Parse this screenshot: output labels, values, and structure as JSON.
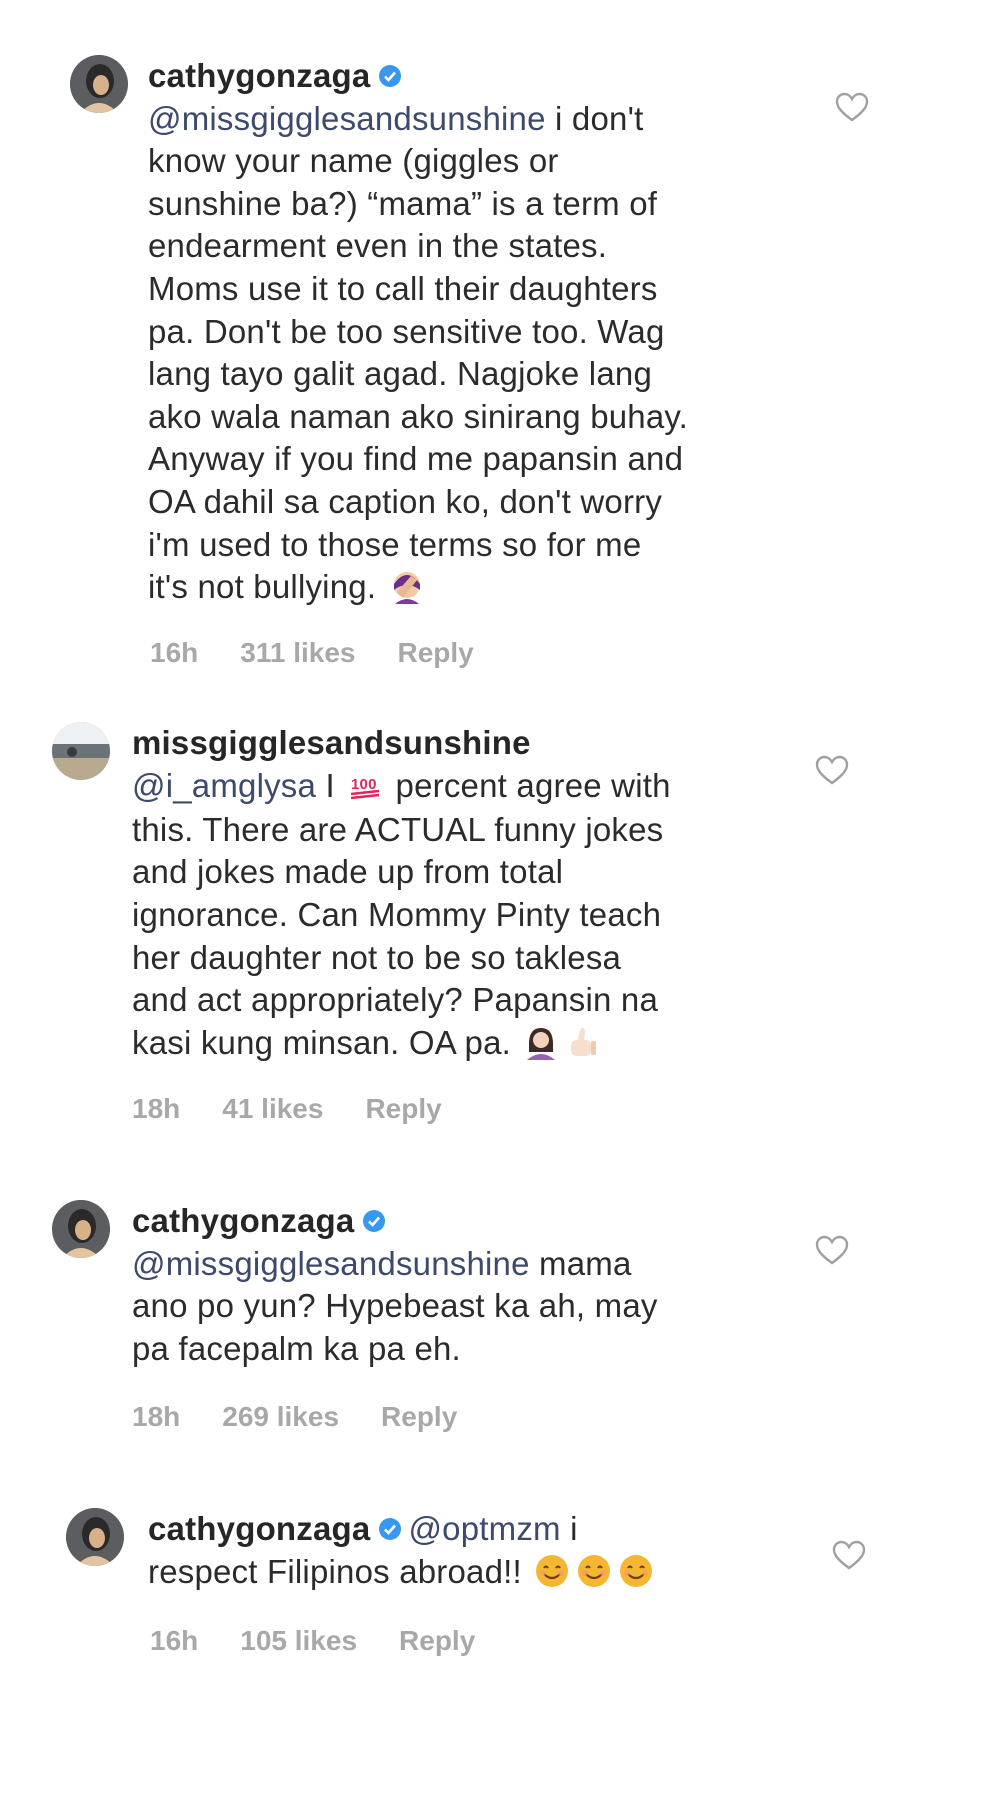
{
  "colors": {
    "text": "#262626",
    "meta": "#a8a8a8",
    "mention": "#3d4a6b",
    "verified": "#3897f0"
  },
  "comments": [
    {
      "username": "cathygonzaga",
      "verified": true,
      "mention": "@missgigglesandsunshine",
      "lines": [
        " i don't",
        "know your name (giggles or",
        "sunshine ba?) “mama” is a term of",
        "endearment even in the states.",
        "Moms use it to call their daughters",
        "pa. Don't be too sensitive too. Wag",
        "lang tayo galit agad. Nagjoke lang",
        "ako wala naman ako sinirang buhay.",
        "Anyway if you find me papansin and",
        "OA dahil sa caption ko, don't worry",
        "i'm used to those terms so for me",
        "it's not bullying."
      ],
      "emoji": [
        "facepalm-emoji-icon"
      ],
      "time": "16h",
      "likes": "311 likes",
      "reply": "Reply"
    },
    {
      "username": "missgigglesandsunshine",
      "verified": false,
      "mention": "@i_amglysa",
      "line1_a": " I ",
      "line1_b": " percent agree with",
      "lines": [
        "this. There are ACTUAL funny jokes",
        "and jokes made up from total",
        "ignorance. Can Mommy Pinty teach",
        "her daughter not to be so taklesa",
        "and act appropriately? Papansin na",
        "kasi kung minsan. OA pa."
      ],
      "emoji": [
        "hundred-points-emoji-icon",
        "woman-gesturing-emoji-icon",
        "thumbs-up-emoji-icon"
      ],
      "time": "18h",
      "likes": "41 likes",
      "reply": "Reply"
    },
    {
      "username": "cathygonzaga",
      "verified": true,
      "mention": "@missgigglesandsunshine",
      "lines": [
        " mama",
        "ano po yun? Hypebeast ka ah, may",
        "pa facepalm ka pa eh."
      ],
      "time": "18h",
      "likes": "269 likes",
      "reply": "Reply"
    },
    {
      "username": "cathygonzaga",
      "verified": true,
      "mention": "@optmzm",
      "lines": [
        " i",
        "respect Filipinos abroad!!"
      ],
      "emoji": [
        "smiling-face-emoji-icon",
        "smiling-face-emoji-icon",
        "smiling-face-emoji-icon"
      ],
      "time": "16h",
      "likes": "105 likes",
      "reply": "Reply"
    }
  ]
}
